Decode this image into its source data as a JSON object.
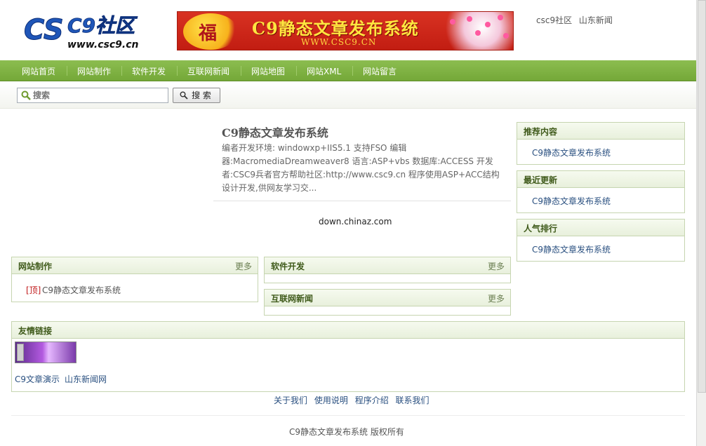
{
  "header": {
    "logo": {
      "main": "CSC9社区",
      "url": "www.csc9.cn"
    },
    "banner": {
      "fu_char": "福",
      "title": "C9静态文章发布系统",
      "url": "WWW.CSC9.CN"
    },
    "top_links": [
      "csc9社区",
      "山东新闻"
    ]
  },
  "nav": {
    "items": [
      "网站首页",
      "网站制作",
      "软件开发",
      "互联网新闻",
      "网站地图",
      "网站XML",
      "网站留言"
    ]
  },
  "search": {
    "placeholder": "搜索",
    "button_label": "搜 索"
  },
  "article": {
    "title": "C9静态文章发布系统",
    "description": "编者开发环境: windowxp+IIS5.1 支持FSO 编辑器:MacromediaDreamweaver8 语言:ASP+vbs 数据库:ACCESS 开发者:CSC9兵者官方帮助社区:http://www.csc9.cn 程序使用ASP+ACC结构设计开发,供网友学习交..."
  },
  "ad": {
    "text": "down.chinaz.com"
  },
  "sidebar": {
    "recommend": {
      "title": "推荐内容",
      "link": "C9静态文章发布系统"
    },
    "recent": {
      "title": "最近更新",
      "link": "C9静态文章发布系统"
    },
    "popular": {
      "title": "人气排行",
      "link": "C9静态文章发布系统"
    }
  },
  "sections": {
    "web": {
      "title": "网站制作",
      "more": "更多",
      "item_tag": "[顶]",
      "item_link": "C9静态文章发布系统"
    },
    "software": {
      "title": "软件开发",
      "more": "更多"
    },
    "news": {
      "title": "互联网新闻",
      "more": "更多"
    }
  },
  "friend_links": {
    "title": "友情链接",
    "links": [
      "C9文章演示",
      "山东新闻网"
    ]
  },
  "footer": {
    "links": [
      "关于我们",
      "使用说明",
      "程序介绍",
      "联系我们"
    ],
    "copyright": "C9静态文章发布系统 版权所有"
  },
  "colors": {
    "nav_green": "#7cb042",
    "box_border": "#c6d5b0",
    "link_blue": "#2a5080",
    "banner_red": "#d02a1c"
  }
}
